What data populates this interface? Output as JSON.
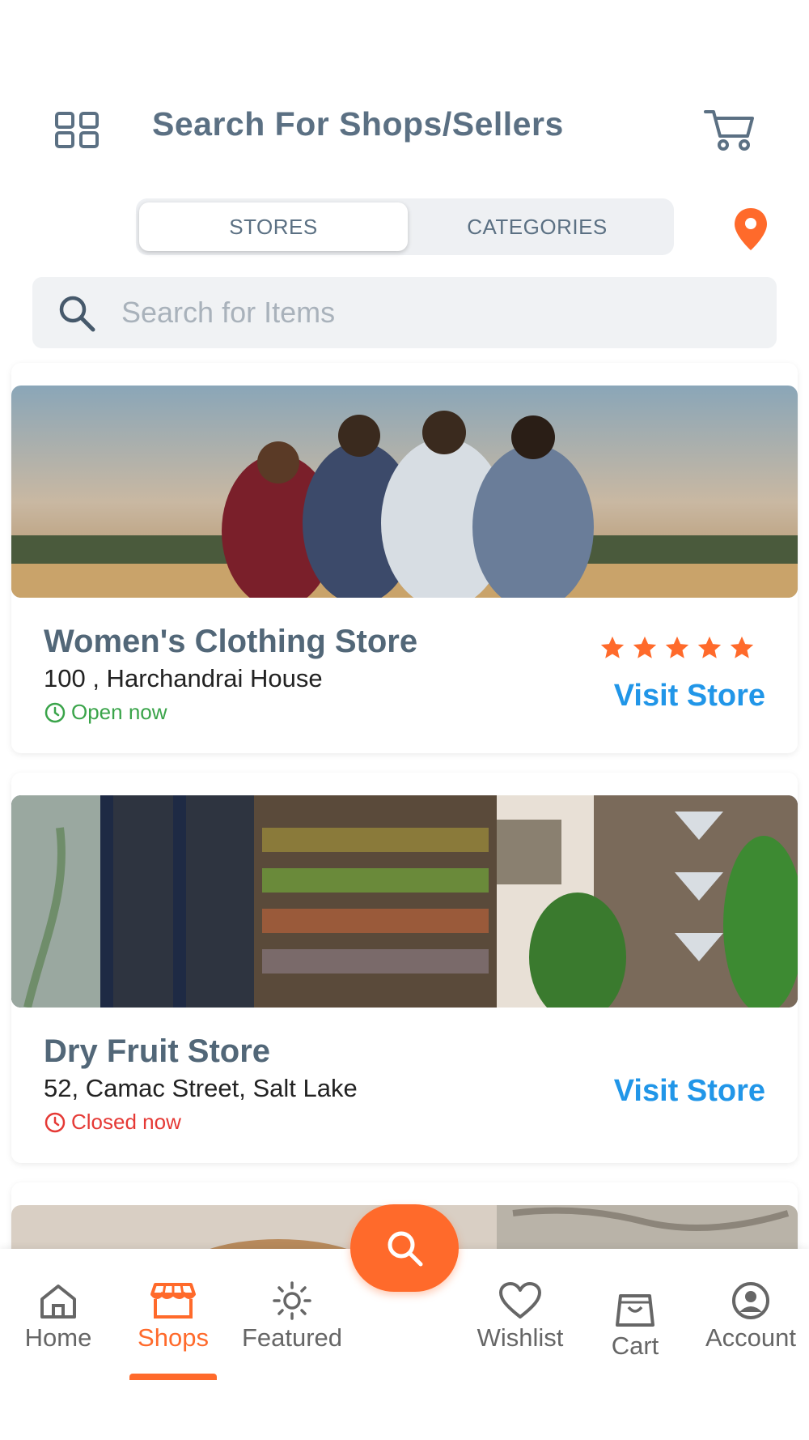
{
  "header": {
    "title": "Search For Shops/Sellers",
    "menu_icon": "grid-icon",
    "cart_icon": "cart-icon"
  },
  "segments": {
    "stores": "STORES",
    "categories": "CATEGORIES",
    "selected": "STORES"
  },
  "location_icon": "map-pin-icon",
  "search": {
    "placeholder": "Search for Items",
    "value": ""
  },
  "stores": [
    {
      "name": "Women's Clothing Store",
      "address": "100 , Harchandrai House",
      "status": "Open now",
      "rating": 5,
      "action": "Visit Store"
    },
    {
      "name": "Dry Fruit Store",
      "address": "52, Camac Street, Salt Lake",
      "status": "Closed now",
      "action": "Visit Store"
    }
  ],
  "bottom_nav": {
    "items": [
      {
        "label": "Home",
        "icon": "home-icon"
      },
      {
        "label": "Shops",
        "icon": "shop-icon",
        "active": true
      },
      {
        "label": "Featured",
        "icon": "sun-icon"
      },
      {
        "label": "Wishlist",
        "icon": "heart-icon"
      },
      {
        "label": "Cart",
        "icon": "bag-icon"
      },
      {
        "label": "Account",
        "icon": "account-icon"
      }
    ],
    "fab_icon": "search-icon"
  },
  "colors": {
    "accent": "#ff6a2b",
    "title": "#5b7083",
    "link": "#2196e8",
    "open": "#3aa44a",
    "closed": "#e53935"
  }
}
